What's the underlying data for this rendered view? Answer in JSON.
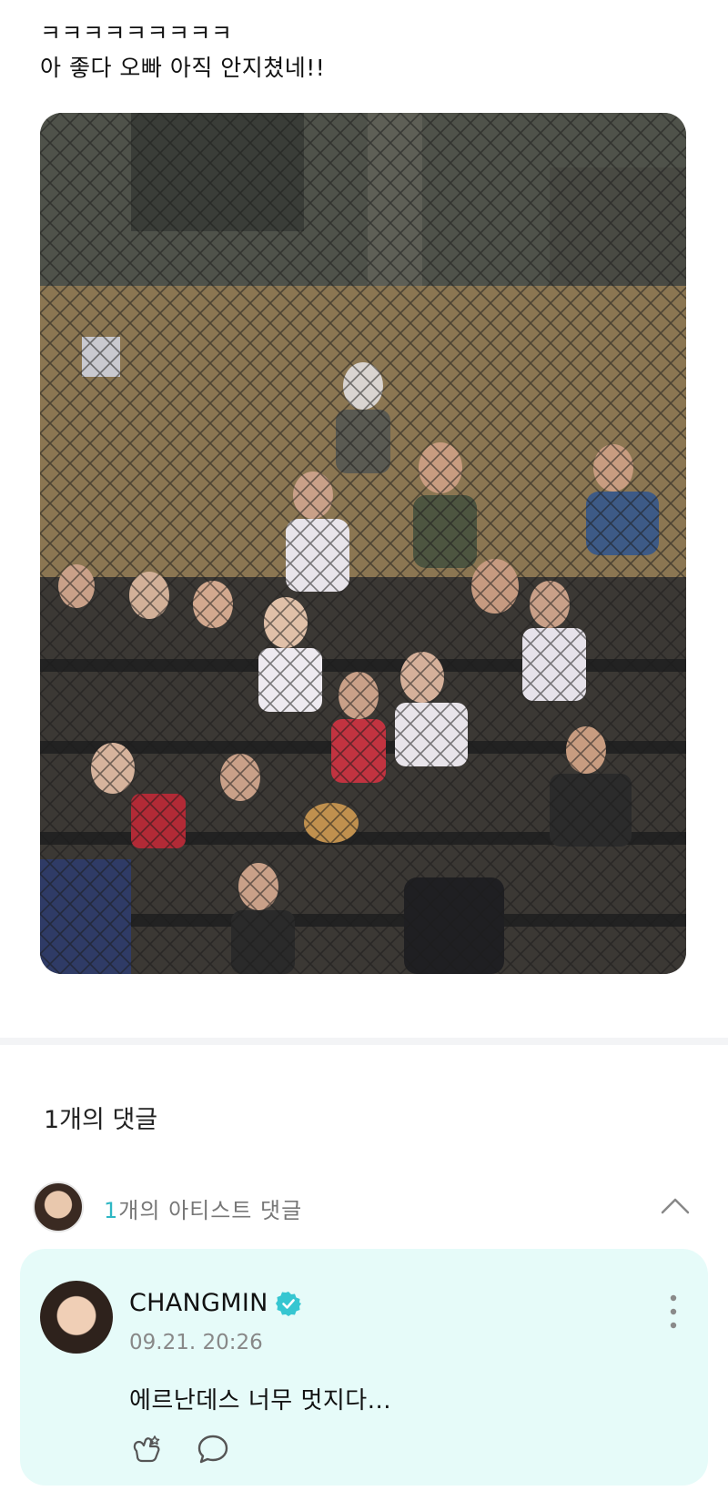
{
  "post": {
    "lines": [
      "ㅋㅋㅋㅋㅋㅋㅋㅋㅋ",
      "아 좋다 오빠 아직 안지쳤네!!"
    ]
  },
  "comments": {
    "count_label": "1개의 댓글",
    "artist_count": "1",
    "artist_label_rest": "개의 아티스트 댓글"
  },
  "comment": {
    "author": "CHANGMIN",
    "timestamp": "09.21. 20:26",
    "text": "에르난데스 너무 멋지다..."
  },
  "icons": {
    "verified": "verified-badge-icon",
    "collapse": "chevron-up-icon",
    "more": "more-vertical-icon",
    "like": "like-icon",
    "reply": "reply-bubble-icon"
  },
  "colors": {
    "accent": "#2fb7c4",
    "card_bg": "#e6fbf9",
    "verified": "#36c6d1"
  }
}
